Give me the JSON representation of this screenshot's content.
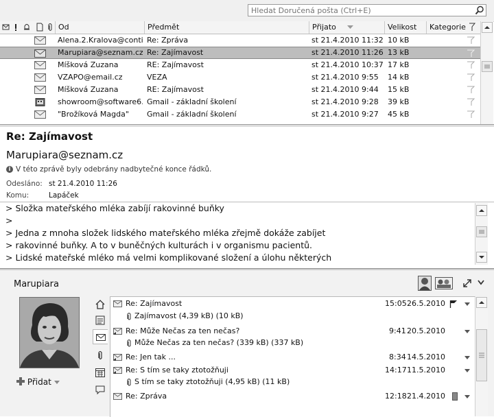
{
  "search": {
    "placeholder": "Hledat Doručená pošta (Ctrl+E)"
  },
  "list_header": {
    "col_from": "Od",
    "col_subject": "Předmět",
    "col_received": "Přijato",
    "col_size": "Velikost",
    "col_category": "Kategorie"
  },
  "messages": [
    {
      "from": "Alena.2.Kralova@conti...",
      "subject": "Re: Zpráva",
      "received": "st 21.4.2010 11:32",
      "size": "10 kB",
      "icon": "envelope-icon",
      "selected": false
    },
    {
      "from": "Marupiara@seznam.cz",
      "subject": "Re: Zajímavost",
      "received": "st 21.4.2010 11:26",
      "size": "13 kB",
      "icon": "envelope-icon",
      "selected": true
    },
    {
      "from": "Míšková Zuzana",
      "subject": "RE: Zajímavost",
      "received": "st 21.4.2010 10:37",
      "size": "17 kB",
      "icon": "envelope-icon",
      "selected": false
    },
    {
      "from": "VZAPO@email.cz",
      "subject": "VEZA",
      "received": "st 21.4.2010 9:55",
      "size": "14 kB",
      "icon": "envelope-icon",
      "selected": false
    },
    {
      "from": "Míšková Zuzana",
      "subject": "RE: Zajímavost",
      "received": "st 21.4.2010 9:44",
      "size": "15 kB",
      "icon": "envelope-icon",
      "selected": false
    },
    {
      "from": "showroom@software6...",
      "subject": "Gmail - základní školení",
      "received": "st 21.4.2010 9:28",
      "size": "39 kB",
      "icon": "meeting-icon",
      "selected": false
    },
    {
      "from": "\"Brožíková Magda\"",
      "subject": "Gmail - základní školení",
      "received": "st 21.4.2010 9:27",
      "size": "45 kB",
      "icon": "envelope-icon",
      "selected": false
    }
  ],
  "reading": {
    "subject": "Re: Zajímavost",
    "sender": "Marupiara@seznam.cz",
    "info": "V této zprávě byly odebrány nadbytečné konce řádků.",
    "sent_label": "Odesláno:",
    "sent_value": "st 21.4.2010 11:26",
    "to_label": "Komu:",
    "to_value": "Lapáček",
    "body_lines": [
      ">      Složka mateřského mléka zabíjí rakovinné buňky",
      ">",
      "> Jedna z mnoha složek lidského mateřského mléka zřejmě dokáže zabíjet",
      "> rakovinné buňky. A to v buněčných kulturách i v organismu pacientů.",
      "> Lidské mateřské mléko má velmi komplikované složení a úlohu některých"
    ]
  },
  "people": {
    "name": "Marupiara",
    "add_label": "Přidat",
    "items": [
      {
        "subject": "Re: Zajímavost",
        "attachment": "Zajímavost (4,39 kB) (10 kB)",
        "time": "15:05",
        "date": "26.5.2010",
        "flag": true
      },
      {
        "subject": "Re: Může Nečas za ten nečas?",
        "attachment": "Může Nečas za ten nečas? (339 kB) (337 kB)",
        "time": "9:41",
        "date": "20.5.2010",
        "flag": false
      },
      {
        "subject": "Re: Jen tak ...",
        "attachment": "",
        "time": "8:34",
        "date": "14.5.2010",
        "flag": false
      },
      {
        "subject": "Re: S tím se taky ztotožňuji",
        "attachment": "S tím se taky ztotožňuji (4,95 kB) (11 kB)",
        "time": "14:17",
        "date": "11.5.2010",
        "flag": false
      },
      {
        "subject": "Re: Zpráva",
        "attachment": "",
        "time": "12:18",
        "date": "21.4.2010",
        "flag": false
      }
    ]
  }
}
